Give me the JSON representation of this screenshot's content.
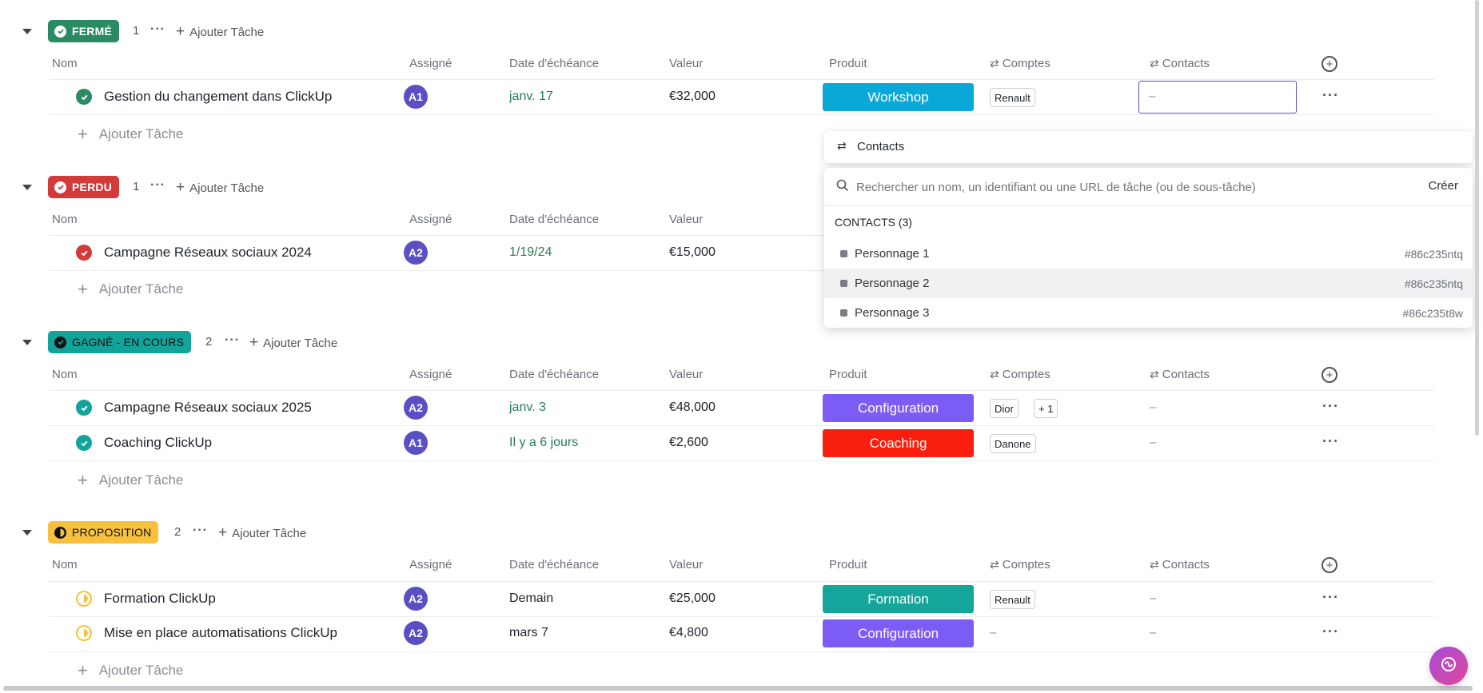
{
  "columns": {
    "nom": "Nom",
    "assigne": "Assigné",
    "date": "Date d'échéance",
    "valeur": "Valeur",
    "produit": "Produit",
    "comptes": "Comptes",
    "contacts": "Contacts"
  },
  "add_task": "Ajouter Tâche",
  "dash": "–",
  "colors": {
    "ferme": "#2a8a63",
    "perdu": "#d33a3a",
    "gagne": "#12a39a",
    "proposition": "#f7c13d",
    "workshop": "#0aa8d6",
    "configuration": "#7b5cf5",
    "coaching": "#fa1e0e",
    "formation": "#14a69a",
    "avatar": "#5b4fc4",
    "date_green": "#2a7b5a"
  },
  "groups": [
    {
      "status": "FERMÉ",
      "count": "1",
      "tasks": [
        {
          "name": "Gestion du changement dans ClickUp",
          "assignee": "A1",
          "date": "janv. 17",
          "value": "€32,000",
          "product": "Workshop",
          "accounts": [
            "Renault"
          ],
          "contacts": "–"
        }
      ]
    },
    {
      "status": "PERDU",
      "count": "1",
      "tasks": [
        {
          "name": "Campagne Réseaux sociaux 2024",
          "assignee": "A2",
          "date": "1/19/24",
          "value": "€15,000"
        }
      ]
    },
    {
      "status": "GAGNÉ - EN COURS",
      "count": "2",
      "tasks": [
        {
          "name": "Campagne Réseaux sociaux 2025",
          "assignee": "A2",
          "date": "janv. 3",
          "value": "€48,000",
          "product": "Configuration",
          "accounts": [
            "Dior",
            "+ 1"
          ],
          "contacts": "–"
        },
        {
          "name": "Coaching ClickUp",
          "assignee": "A1",
          "date": "Il y a 6 jours",
          "value": "€2,600",
          "product": "Coaching",
          "accounts": [
            "Danone"
          ],
          "contacts": "–"
        }
      ]
    },
    {
      "status": "PROPOSITION",
      "count": "2",
      "tasks": [
        {
          "name": "Formation ClickUp",
          "assignee": "A2",
          "date": "Demain",
          "value": "€25,000",
          "product": "Formation",
          "accounts": [
            "Renault"
          ],
          "contacts": "–"
        },
        {
          "name": "Mise en place automatisations ClickUp",
          "assignee": "A2",
          "date": "mars 7",
          "value": "€4,800",
          "product": "Configuration",
          "accounts": [],
          "contacts": "–"
        }
      ]
    }
  ],
  "popup": {
    "title": "Contacts",
    "search_placeholder": "Rechercher un nom, un identifiant ou une URL de tâche (ou de sous-tâche)",
    "create_label": "Créer",
    "section_label": "CONTACTS (3)",
    "items": [
      {
        "name": "Personnage 1",
        "id": "#86c235ntq"
      },
      {
        "name": "Personnage 2",
        "id": "#86c235ntq"
      },
      {
        "name": "Personnage 3",
        "id": "#86c235t8w"
      }
    ]
  }
}
